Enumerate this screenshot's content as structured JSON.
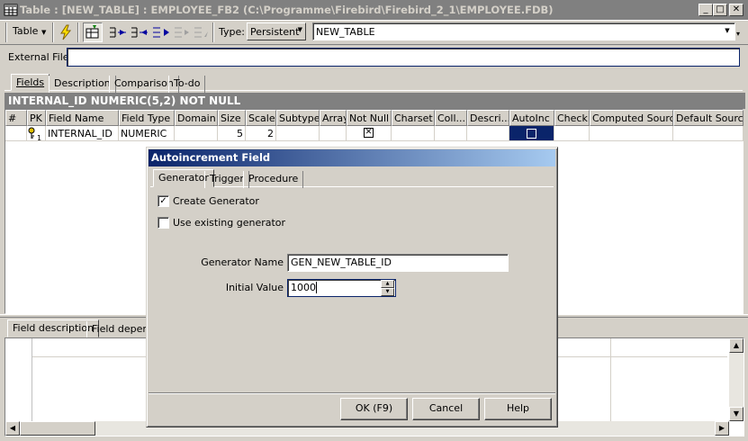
{
  "window": {
    "title": "Table : [NEW_TABLE] : EMPLOYEE_FB2 (C:\\Programme\\Firebird\\Firebird_2_1\\EMPLOYEE.FDB)",
    "minimize": "_",
    "maximize": "□",
    "close": "✕"
  },
  "toolbar": {
    "table_menu": "Table",
    "type_label": "Type:",
    "type_value": "Persistent",
    "table_name": "NEW_TABLE"
  },
  "external_file": {
    "label": "External File",
    "value": ""
  },
  "tabs": [
    "Fields",
    "Description",
    "Comparison",
    "To-do"
  ],
  "field_header": "INTERNAL_ID NUMERIC(5,2) NOT NULL",
  "grid": {
    "columns": [
      "#",
      "PK",
      "Field Name",
      "Field Type",
      "Domain",
      "Size",
      "Scale",
      "Subtype",
      "Array",
      "Not Null",
      "Charset",
      "Coll...",
      "Descri...",
      "AutoInc",
      "Check",
      "Computed Source",
      "Default Source"
    ],
    "rows": [
      {
        "pk_marker": "1",
        "field_name": "INTERNAL_ID",
        "field_type": "NUMERIC",
        "domain": "",
        "size": "5",
        "scale": "2",
        "not_null": true,
        "autoinc": false
      }
    ]
  },
  "bottom_tabs": [
    "Field description",
    "Field depende"
  ],
  "dialog": {
    "title": "Autoincrement Field",
    "tabs": [
      "Generator",
      "Trigger",
      "Procedure"
    ],
    "create_generator": {
      "label": "Create Generator",
      "checked": true
    },
    "use_existing": {
      "label": "Use existing generator",
      "checked": false
    },
    "generator_name_label": "Generator Name",
    "generator_name": "GEN_NEW_TABLE_ID",
    "initial_value_label": "Initial Value",
    "initial_value": "1000",
    "buttons": {
      "ok": "OK (F9)",
      "cancel": "Cancel",
      "help": "Help"
    }
  },
  "colors": {
    "face": "#d4d0c8",
    "title_active": "#0a246a",
    "header_bar": "#808080",
    "selection": "#0a246a"
  }
}
